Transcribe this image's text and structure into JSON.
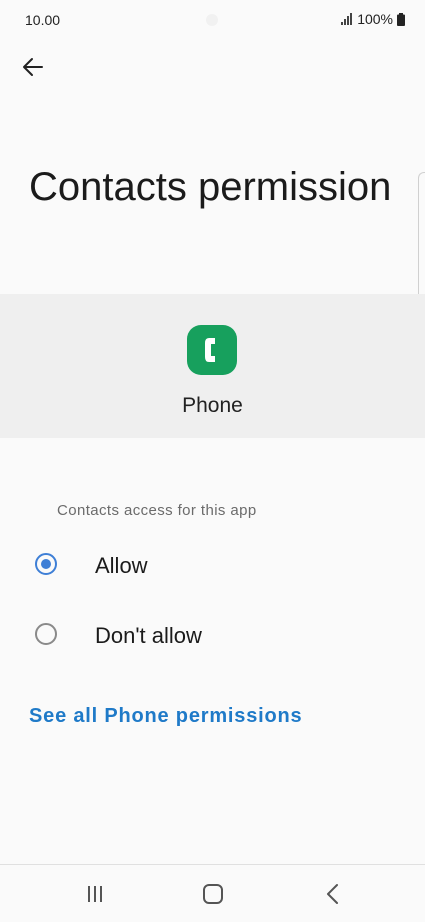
{
  "status_bar": {
    "time": "10.00",
    "battery": "100%"
  },
  "page": {
    "title": "Contacts permission"
  },
  "app": {
    "name": "Phone",
    "icon": "phone-app-icon",
    "icon_color": "#17a05d"
  },
  "permission": {
    "section_label": "Contacts access for this app",
    "options": [
      {
        "label": "Allow",
        "selected": true
      },
      {
        "label": "Don't allow",
        "selected": false
      }
    ]
  },
  "link": {
    "see_all": "See all Phone permissions"
  },
  "colors": {
    "accent": "#3e7fd6",
    "link": "#1f7ac8",
    "header_bg": "#efefef"
  },
  "nav": {
    "icons": [
      "recents-icon",
      "home-icon",
      "back-icon"
    ]
  }
}
